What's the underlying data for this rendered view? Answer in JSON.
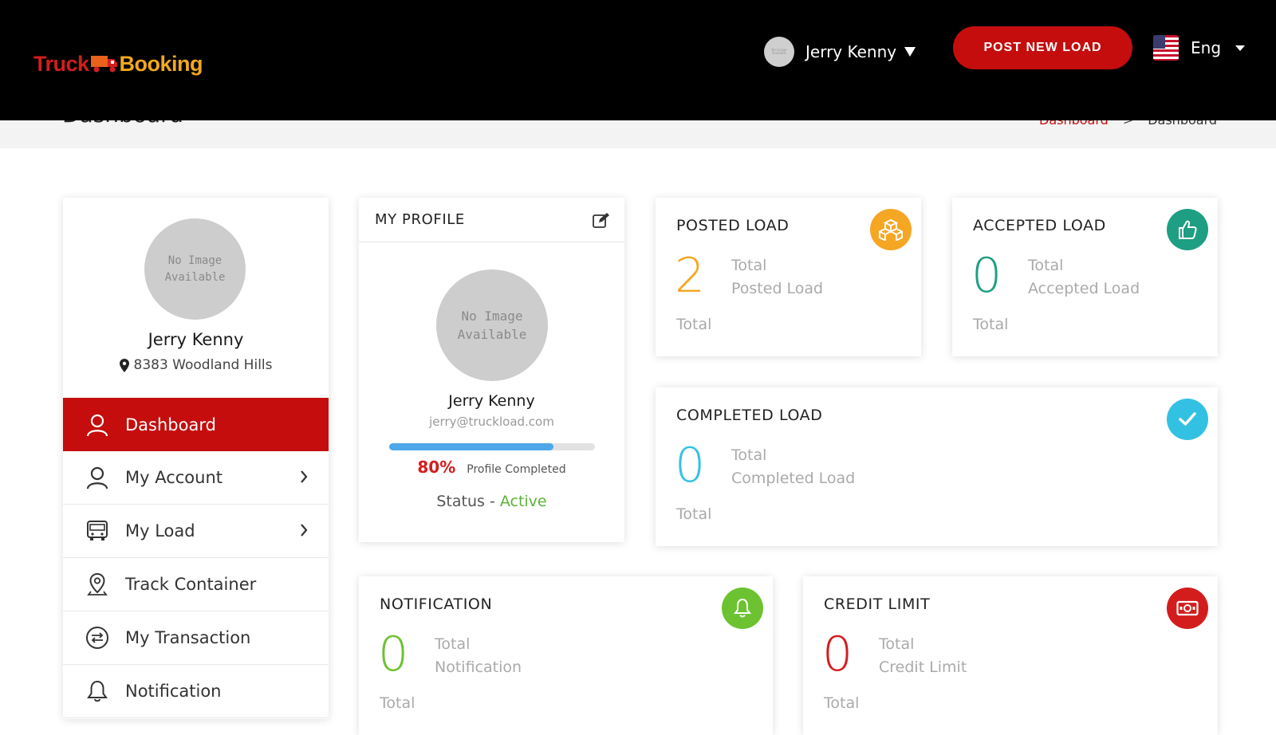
{
  "header": {
    "logo_part1": "Truck",
    "logo_part2": "Booking",
    "user_name": "Jerry Kenny",
    "post_button": "POST NEW LOAD",
    "language": "Eng"
  },
  "page": {
    "title": "Dashboard",
    "breadcrumb": [
      "Dashboard",
      ">",
      "Dashboard"
    ]
  },
  "sidebar": {
    "avatar_text_1": "No Image",
    "avatar_text_2": "Available",
    "name": "Jerry Kenny",
    "location": "8383 Woodland Hills",
    "items": [
      {
        "label": "Dashboard",
        "icon": "user-icon",
        "active": true
      },
      {
        "label": "My Account",
        "icon": "user-icon",
        "has_chevron": true
      },
      {
        "label": "My Load",
        "icon": "truck-icon",
        "has_chevron": true
      },
      {
        "label": "Track Container",
        "icon": "location-pin-icon"
      },
      {
        "label": "My Transaction",
        "icon": "exchange-icon"
      },
      {
        "label": "Notification",
        "icon": "bell-icon"
      }
    ]
  },
  "profile": {
    "title": "MY PROFILE",
    "avatar_text_1": "No Image",
    "avatar_text_2": "Available",
    "name": "Jerry Kenny",
    "email": "jerry@truckload.com",
    "progress_percent": 80,
    "progress_text": "80%",
    "progress_label": "Profile Completed",
    "status_label": "Status - ",
    "status_value": "Active"
  },
  "stats": {
    "posted": {
      "title": "POSTED LOAD",
      "value": "2",
      "label1": "Total",
      "label2": "Posted Load",
      "total": "Total",
      "color": "#f5a623",
      "icon": "boxes-icon"
    },
    "accepted": {
      "title": "ACCEPTED LOAD",
      "value": "0",
      "label1": "Total",
      "label2": "Accepted Load",
      "total": "Total",
      "color": "#1e9e82",
      "icon": "thumbs-up-icon"
    },
    "completed": {
      "title": "COMPLETED LOAD",
      "value": "0",
      "label1": "Total",
      "label2": "Completed Load",
      "total": "Total",
      "color": "#33c1e3",
      "icon": "check-icon"
    },
    "notification": {
      "title": "NOTIFICATION",
      "value": "0",
      "label1": "Total",
      "label2": "Notification",
      "total": "Total",
      "color": "#6cc230",
      "icon": "bell-icon"
    },
    "credit": {
      "title": "CREDIT LIMIT",
      "value": "0",
      "label1": "Total",
      "label2": "Credit Limit",
      "total": "Total",
      "color": "#d31d1d",
      "icon": "money-icon"
    }
  }
}
